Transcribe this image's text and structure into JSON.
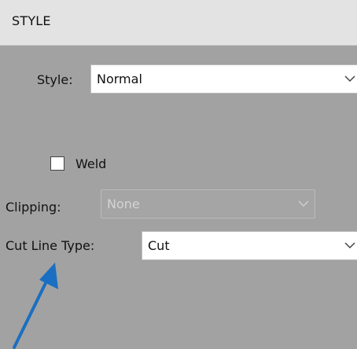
{
  "header": {
    "title": "STYLE"
  },
  "style_field": {
    "label": "Style:",
    "value": "Normal"
  },
  "weld": {
    "label": "Weld",
    "checked": false
  },
  "clipping_field": {
    "label": "Clipping:",
    "value": "None",
    "disabled": true
  },
  "cut_line_type_field": {
    "label": "Cut Line Type:",
    "value": "Cut"
  },
  "colors": {
    "panel_bg": "#a2a2a2",
    "header_bg": "#e3e3e3",
    "arrow": "#1a6fc2"
  },
  "icons": {
    "dropdown": "chevron-down-icon",
    "annotation": "arrow-up-right-icon"
  }
}
